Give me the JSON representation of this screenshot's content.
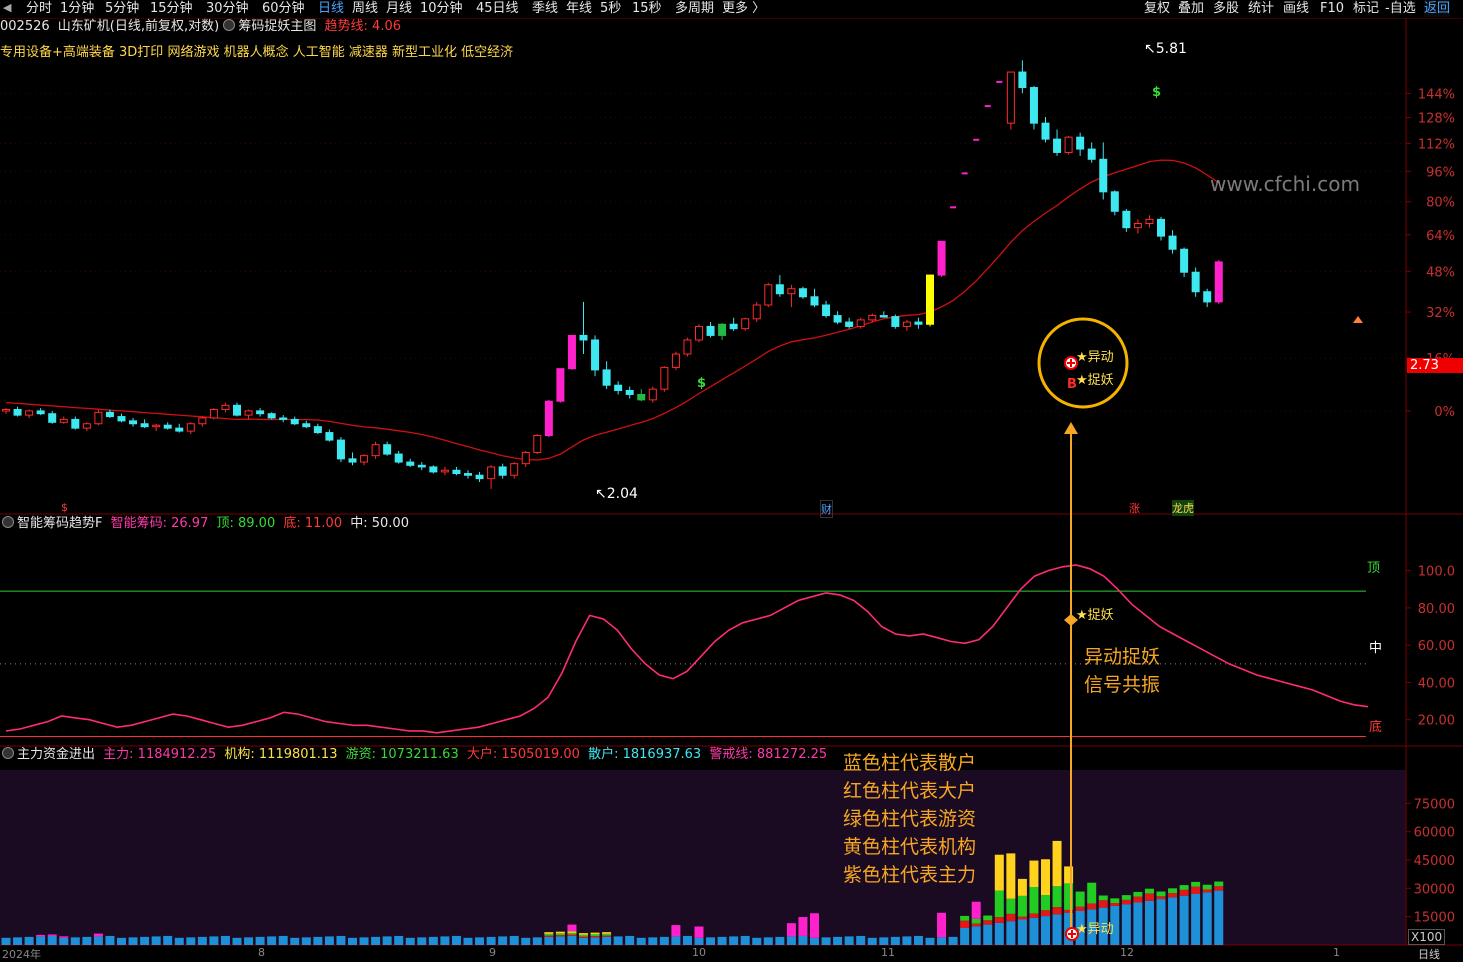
{
  "toolbar": {
    "arrow_left": "◀",
    "periods": [
      "分时",
      "1分钟",
      "5分钟",
      "15分钟",
      "30分钟",
      "60分钟",
      "日线",
      "周线",
      "月线",
      "10分钟",
      "45日线",
      "季线",
      "年线",
      "5秒",
      "15秒",
      "多周期",
      "更多 〉"
    ],
    "active_period": "日线",
    "right_items": [
      "复权",
      "叠加",
      "多股",
      "统计",
      "画线",
      "F10",
      "标记",
      "-自选",
      "返回"
    ]
  },
  "header": {
    "code": "002526",
    "name": "山东矿机",
    "mode": "(日线,前复权,对数)",
    "indicator_name": "筹码捉妖主图",
    "trend_label": "趋势线:",
    "trend_value": "4.06"
  },
  "concepts": "专用设备+高端装备  3D打印  网络游戏  机器人概念  人工智能  减速器  新型工业化  低空经济",
  "main_chart": {
    "pct_axis": [
      "144%",
      "128%",
      "112%",
      "96%",
      "80%",
      "64%",
      "48%",
      "32%",
      "16%",
      "0%"
    ],
    "high_label": "5.81",
    "low_label": "2.04",
    "current_price": "2.73",
    "signal_yidong": "★异动",
    "signal_zhuoyao": "★捉妖",
    "marker_b": "B",
    "marker_s1": "$",
    "marker_s2": "$",
    "marker_s3": "$",
    "event_cai": "财",
    "event_zhang": "涨",
    "event_longhu": "龙虎",
    "watermark": "www.cfchi.com"
  },
  "panel2": {
    "title": "智能筹码趋势F",
    "smart_label": "智能筹码: 26.97",
    "top_label": "顶: 89.00",
    "bottom_label": "底: 11.00",
    "mid_label": "中: 50.00",
    "axis": [
      "100.0",
      "80.00",
      "60.00",
      "40.00",
      "20.00"
    ],
    "top_text": "顶",
    "mid_text": "中",
    "bottom_text": "底",
    "signal": "★捉妖",
    "callout_lines": [
      "异动捉妖",
      "信号共振"
    ]
  },
  "panel3": {
    "title": "主力资金进出",
    "main_force": "主力: 1184912.25",
    "institution": "机构: 1119801.13",
    "hot_money": "游资: 1073211.63",
    "big_holder": "大户: 1505019.00",
    "retail": "散户: 1816937.63",
    "alert": "警戒线: 881272.25",
    "axis": [
      "75000",
      "60000",
      "45000",
      "30000",
      "15000"
    ],
    "unit": "X100",
    "signal": "★异动",
    "legend": [
      "蓝色柱代表散户",
      "红色柱代表大户",
      "绿色柱代表游资",
      "黄色柱代表机构",
      "紫色柱代表主力"
    ]
  },
  "footer": {
    "year_label": "2024年",
    "months": [
      "8",
      "9",
      "10",
      "11",
      "12",
      "1"
    ],
    "period_label": "日线"
  },
  "chart_data": {
    "type": "candlestick",
    "colors": {
      "up": "#ff2a2a",
      "down": "#3ee8f0",
      "limit_up": "#ff22cc",
      "ma": "#d01010"
    },
    "ohlc": [
      [
        2.54,
        2.56,
        2.52,
        2.55
      ],
      [
        2.55,
        2.57,
        2.5,
        2.51
      ],
      [
        2.51,
        2.55,
        2.49,
        2.54
      ],
      [
        2.54,
        2.56,
        2.51,
        2.52
      ],
      [
        2.52,
        2.54,
        2.45,
        2.46
      ],
      [
        2.46,
        2.5,
        2.45,
        2.48
      ],
      [
        2.48,
        2.5,
        2.41,
        2.42
      ],
      [
        2.42,
        2.46,
        2.4,
        2.45
      ],
      [
        2.45,
        2.55,
        2.44,
        2.53
      ],
      [
        2.53,
        2.55,
        2.49,
        2.5
      ],
      [
        2.5,
        2.52,
        2.46,
        2.47
      ],
      [
        2.47,
        2.49,
        2.43,
        2.45
      ],
      [
        2.45,
        2.48,
        2.42,
        2.43
      ],
      [
        2.43,
        2.45,
        2.4,
        2.44
      ],
      [
        2.44,
        2.46,
        2.41,
        2.42
      ],
      [
        2.42,
        2.45,
        2.39,
        2.4
      ],
      [
        2.4,
        2.46,
        2.38,
        2.45
      ],
      [
        2.45,
        2.5,
        2.43,
        2.49
      ],
      [
        2.49,
        2.56,
        2.48,
        2.55
      ],
      [
        2.55,
        2.6,
        2.53,
        2.58
      ],
      [
        2.58,
        2.6,
        2.5,
        2.51
      ],
      [
        2.51,
        2.55,
        2.48,
        2.54
      ],
      [
        2.54,
        2.56,
        2.5,
        2.52
      ],
      [
        2.52,
        2.53,
        2.48,
        2.49
      ],
      [
        2.49,
        2.51,
        2.46,
        2.48
      ],
      [
        2.48,
        2.5,
        2.44,
        2.45
      ],
      [
        2.45,
        2.47,
        2.42,
        2.43
      ],
      [
        2.43,
        2.45,
        2.38,
        2.39
      ],
      [
        2.39,
        2.41,
        2.33,
        2.34
      ],
      [
        2.34,
        2.36,
        2.2,
        2.22
      ],
      [
        2.22,
        2.26,
        2.18,
        2.2
      ],
      [
        2.2,
        2.25,
        2.18,
        2.24
      ],
      [
        2.24,
        2.33,
        2.22,
        2.31
      ],
      [
        2.31,
        2.33,
        2.24,
        2.25
      ],
      [
        2.25,
        2.27,
        2.19,
        2.2
      ],
      [
        2.2,
        2.22,
        2.17,
        2.18
      ],
      [
        2.18,
        2.2,
        2.15,
        2.17
      ],
      [
        2.17,
        2.18,
        2.13,
        2.14
      ],
      [
        2.14,
        2.17,
        2.12,
        2.15
      ],
      [
        2.15,
        2.17,
        2.12,
        2.13
      ],
      [
        2.13,
        2.15,
        2.1,
        2.12
      ],
      [
        2.12,
        2.14,
        2.08,
        2.1
      ],
      [
        2.1,
        2.18,
        2.04,
        2.17
      ],
      [
        2.17,
        2.19,
        2.1,
        2.12
      ],
      [
        2.12,
        2.2,
        2.1,
        2.19
      ],
      [
        2.19,
        2.27,
        2.17,
        2.26
      ],
      [
        2.26,
        2.38,
        2.25,
        2.37
      ],
      [
        2.37,
        2.62,
        2.36,
        2.61
      ],
      [
        2.61,
        2.86,
        2.6,
        2.86
      ],
      [
        2.86,
        3.14,
        2.85,
        3.14
      ],
      [
        3.14,
        3.45,
        2.98,
        3.1
      ],
      [
        3.1,
        3.14,
        2.8,
        2.85
      ],
      [
        2.85,
        2.92,
        2.7,
        2.73
      ],
      [
        2.73,
        2.76,
        2.66,
        2.69
      ],
      [
        2.69,
        2.72,
        2.63,
        2.66
      ],
      [
        2.66,
        2.7,
        2.61,
        2.62
      ],
      [
        2.62,
        2.72,
        2.6,
        2.7
      ],
      [
        2.7,
        2.88,
        2.68,
        2.87
      ],
      [
        2.87,
        3.0,
        2.85,
        2.98
      ],
      [
        2.98,
        3.12,
        2.96,
        3.1
      ],
      [
        3.1,
        3.24,
        3.08,
        3.22
      ],
      [
        3.22,
        3.26,
        3.12,
        3.14
      ],
      [
        3.14,
        3.25,
        3.1,
        3.24
      ],
      [
        3.24,
        3.3,
        3.18,
        3.2
      ],
      [
        3.2,
        3.3,
        3.18,
        3.29
      ],
      [
        3.29,
        3.45,
        3.26,
        3.42
      ],
      [
        3.42,
        3.64,
        3.4,
        3.62
      ],
      [
        3.62,
        3.72,
        3.5,
        3.53
      ],
      [
        3.53,
        3.62,
        3.4,
        3.58
      ],
      [
        3.58,
        3.6,
        3.48,
        3.5
      ],
      [
        3.5,
        3.58,
        3.4,
        3.42
      ],
      [
        3.42,
        3.46,
        3.3,
        3.32
      ],
      [
        3.32,
        3.36,
        3.24,
        3.26
      ],
      [
        3.26,
        3.3,
        3.2,
        3.22
      ],
      [
        3.22,
        3.3,
        3.2,
        3.28
      ],
      [
        3.28,
        3.34,
        3.26,
        3.32
      ],
      [
        3.32,
        3.36,
        3.3,
        3.31
      ],
      [
        3.31,
        3.33,
        3.2,
        3.22
      ],
      [
        3.22,
        3.28,
        3.18,
        3.26
      ],
      [
        3.26,
        3.3,
        3.2,
        3.24
      ],
      [
        3.24,
        3.72,
        3.22,
        3.72
      ],
      [
        3.72,
        4.09,
        3.7,
        4.09
      ],
      [
        4.5,
        4.5,
        4.5,
        4.5
      ],
      [
        4.95,
        4.95,
        4.95,
        4.95
      ],
      [
        5.44,
        5.44,
        5.44,
        5.44
      ],
      [
        5.98,
        5.98,
        5.98,
        5.98
      ],
      [
        6.4,
        6.4,
        6.4,
        6.4
      ],
      [
        5.7,
        6.58,
        5.6,
        6.58
      ],
      [
        6.58,
        6.8,
        6.2,
        6.3
      ],
      [
        6.3,
        6.33,
        5.6,
        5.7
      ],
      [
        5.7,
        5.8,
        5.4,
        5.45
      ],
      [
        5.45,
        5.6,
        5.2,
        5.25
      ],
      [
        5.25,
        5.5,
        5.22,
        5.48
      ],
      [
        5.48,
        5.55,
        5.2,
        5.3
      ],
      [
        5.3,
        5.4,
        5.1,
        5.15
      ],
      [
        5.15,
        5.4,
        4.6,
        4.7
      ],
      [
        4.7,
        4.72,
        4.4,
        4.45
      ],
      [
        4.45,
        4.48,
        4.2,
        4.25
      ],
      [
        4.25,
        4.35,
        4.18,
        4.3
      ],
      [
        4.3,
        4.4,
        4.25,
        4.35
      ],
      [
        4.35,
        4.38,
        4.1,
        4.15
      ],
      [
        4.15,
        4.22,
        3.95,
        4.0
      ],
      [
        4.0,
        4.02,
        3.7,
        3.75
      ],
      [
        3.75,
        3.8,
        3.5,
        3.55
      ],
      [
        3.55,
        3.58,
        3.4,
        3.45
      ],
      [
        3.45,
        3.88,
        3.43,
        3.86
      ]
    ],
    "zhuoyao_line": [
      14,
      15,
      17,
      19,
      22,
      21,
      20,
      18,
      16,
      17,
      19,
      21,
      23,
      22,
      20,
      18,
      16,
      17,
      19,
      21,
      24,
      23,
      21,
      19,
      18,
      17,
      17,
      16,
      15,
      14,
      14,
      13,
      14,
      15,
      16,
      18,
      20,
      22,
      26,
      32,
      45,
      62,
      76,
      74,
      68,
      58,
      50,
      44,
      42,
      46,
      54,
      62,
      68,
      72,
      74,
      76,
      80,
      84,
      86,
      88,
      87,
      84,
      78,
      70,
      66,
      65,
      66,
      64,
      62,
      61,
      63,
      70,
      80,
      90,
      97,
      100,
      102,
      103,
      101,
      97,
      90,
      82,
      76,
      70,
      66,
      62,
      58,
      54,
      50,
      47,
      44,
      42,
      40,
      38,
      36,
      33,
      30,
      28,
      27
    ],
    "zhuoyao_levels": {
      "top": 89,
      "mid": 50,
      "bottom": 11
    },
    "money_flow": {
      "series": [
        "散户",
        "大户",
        "游资",
        "机构",
        "主力"
      ]
    }
  }
}
